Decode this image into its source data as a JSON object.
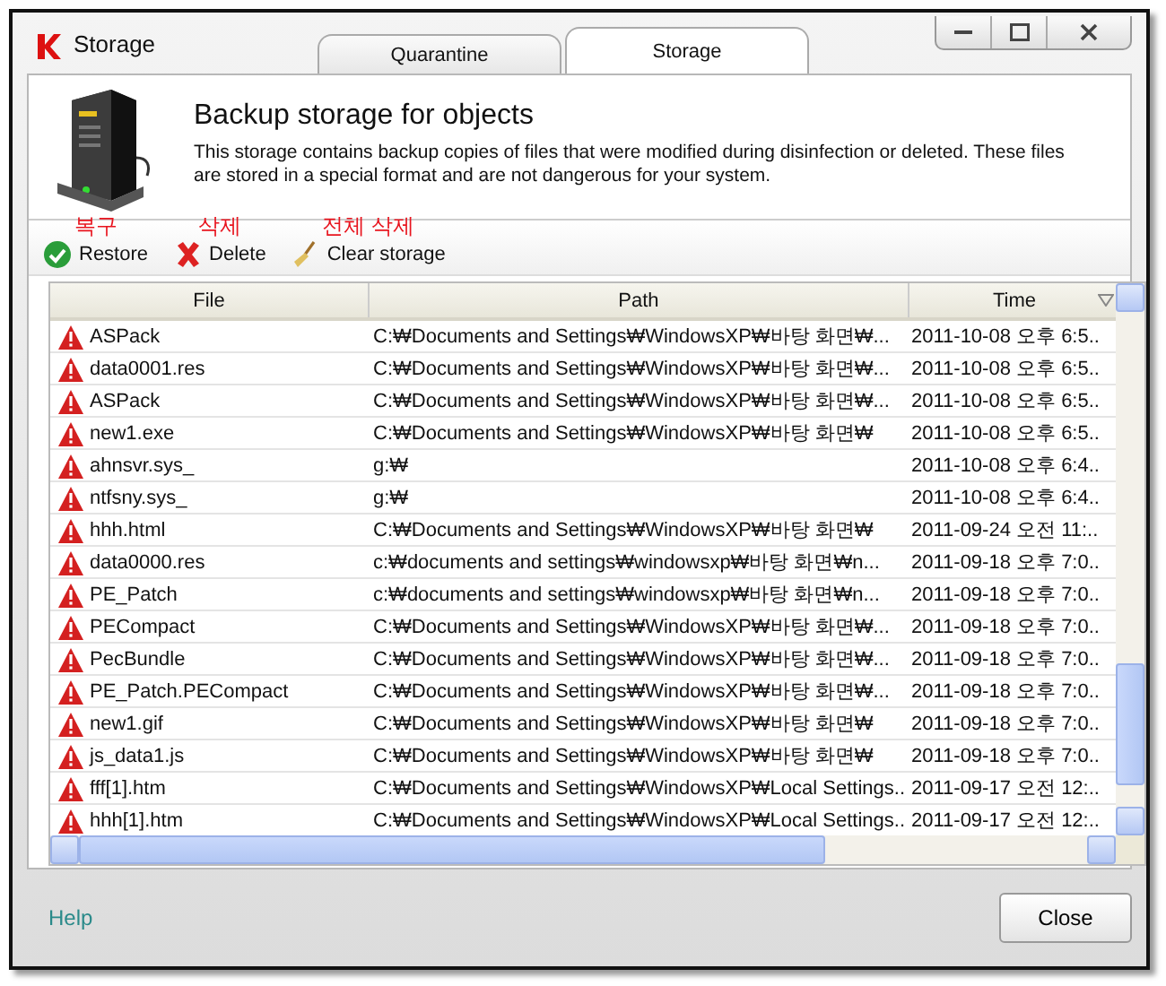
{
  "window": {
    "title": "Storage"
  },
  "tabs": [
    {
      "label": "Quarantine",
      "selected": false
    },
    {
      "label": "Storage",
      "selected": true
    }
  ],
  "header": {
    "title": "Backup storage for objects",
    "description": "This storage contains backup copies of files that were modified during disinfection or deleted. These files are stored in a special format and are not dangerous for your system."
  },
  "toolbar": [
    {
      "kind": "restore",
      "label": "Restore",
      "annotation": "복구"
    },
    {
      "kind": "delete",
      "label": "Delete",
      "annotation": "삭제"
    },
    {
      "kind": "clear",
      "label": "Clear storage",
      "annotation": "전체 삭제"
    }
  ],
  "table": {
    "columns": [
      {
        "label": "File",
        "sorted": false
      },
      {
        "label": "Path",
        "sorted": false
      },
      {
        "label": "Time",
        "sorted": true
      }
    ],
    "rows": [
      [
        "ASPack",
        "C:₩Documents and Settings₩WindowsXP₩바탕 화면₩...",
        "2011-10-08 오후 6:5.."
      ],
      [
        "data0001.res",
        "C:₩Documents and Settings₩WindowsXP₩바탕 화면₩...",
        "2011-10-08 오후 6:5.."
      ],
      [
        "ASPack",
        "C:₩Documents and Settings₩WindowsXP₩바탕 화면₩...",
        "2011-10-08 오후 6:5.."
      ],
      [
        "new1.exe",
        "C:₩Documents and Settings₩WindowsXP₩바탕 화면₩",
        "2011-10-08 오후 6:5.."
      ],
      [
        "ahnsvr.sys_",
        "g:₩",
        "2011-10-08 오후 6:4.."
      ],
      [
        "ntfsny.sys_",
        "g:₩",
        "2011-10-08 오후 6:4.."
      ],
      [
        "hhh.html",
        "C:₩Documents and Settings₩WindowsXP₩바탕 화면₩",
        "2011-09-24 오전 11:.."
      ],
      [
        "data0000.res",
        "c:₩documents and settings₩windowsxp₩바탕 화면₩n...",
        "2011-09-18 오후 7:0.."
      ],
      [
        "PE_Patch",
        "c:₩documents and settings₩windowsxp₩바탕 화면₩n...",
        "2011-09-18 오후 7:0.."
      ],
      [
        "PECompact",
        "C:₩Documents and Settings₩WindowsXP₩바탕 화면₩...",
        "2011-09-18 오후 7:0.."
      ],
      [
        "PecBundle",
        "C:₩Documents and Settings₩WindowsXP₩바탕 화면₩...",
        "2011-09-18 오후 7:0.."
      ],
      [
        "PE_Patch.PECompact",
        "C:₩Documents and Settings₩WindowsXP₩바탕 화면₩...",
        "2011-09-18 오후 7:0.."
      ],
      [
        "new1.gif",
        "C:₩Documents and Settings₩WindowsXP₩바탕 화면₩",
        "2011-09-18 오후 7:0.."
      ],
      [
        "js_data1.js",
        "C:₩Documents and Settings₩WindowsXP₩바탕 화면₩",
        "2011-09-18 오후 7:0.."
      ],
      [
        "fff[1].htm",
        "C:₩Documents and Settings₩WindowsXP₩Local Settings...",
        "2011-09-17 오전 12:.."
      ],
      [
        "hhh[1].htm",
        "C:₩Documents and Settings₩WindowsXP₩Local Settings...",
        "2011-09-17 오전 12:.."
      ]
    ]
  },
  "footer": {
    "help": "Help",
    "close": "Close"
  }
}
